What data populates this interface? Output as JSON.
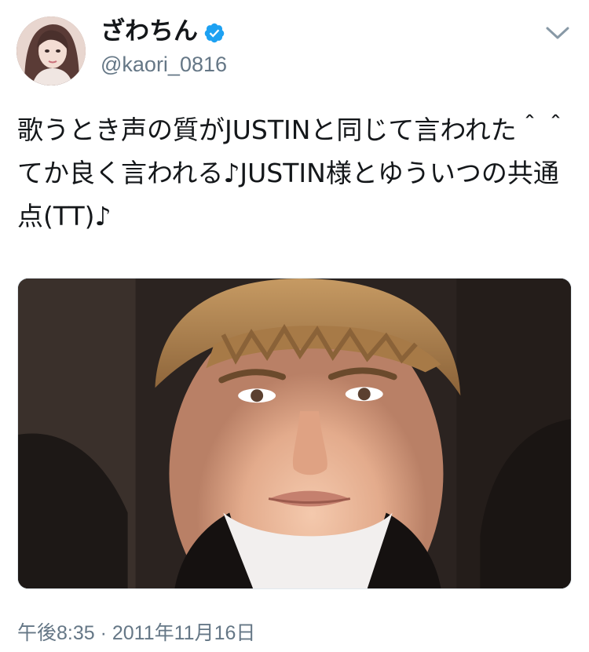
{
  "user": {
    "display_name": "ざわちん",
    "handle": "@kaori_0816",
    "verified_icon": "verified-badge-icon"
  },
  "menu": {
    "icon": "chevron-down-icon"
  },
  "tweet": {
    "text": "歌うとき声の質がJUSTINと同じて言われた＾＾てか良く言われる♪JUSTIN様とゆういつの共通点(TT)♪",
    "media": {
      "kind": "photo"
    },
    "timestamp": "午後8:35 · 2011年11月16日"
  },
  "colors": {
    "text": "#14171a",
    "secondary": "#657786",
    "accent": "#1da1f2"
  }
}
